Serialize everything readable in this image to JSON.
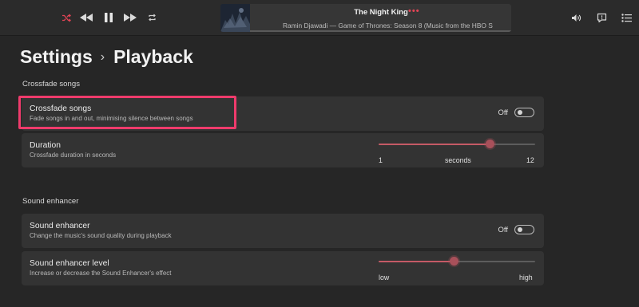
{
  "player": {
    "title": "The Night King",
    "more": "•••",
    "subtitle": "Ramin Djawadi — Game of Thrones: Season 8 (Music from the HBO S",
    "accent": "#e24455",
    "controls": [
      "shuffle-icon",
      "previous-icon",
      "pause-icon",
      "next-icon",
      "repeat-icon"
    ],
    "right_controls": [
      "volume-icon",
      "lyrics-icon",
      "queue-icon"
    ]
  },
  "breadcrumb": {
    "parent": "Settings",
    "separator": "›",
    "current": "Playback"
  },
  "crossfade": {
    "section_title": "Crossfade songs",
    "toggle": {
      "title": "Crossfade songs",
      "description": "Fade songs in and out, minimising silence between songs",
      "state": "Off"
    },
    "duration": {
      "title": "Duration",
      "description": "Crossfade duration in seconds",
      "min": "1",
      "unit": "seconds",
      "max": "12",
      "value_fraction": 0.71
    }
  },
  "enhancer": {
    "section_title": "Sound enhancer",
    "toggle": {
      "title": "Sound enhancer",
      "description": "Change the music's sound quality during playback",
      "state": "Off"
    },
    "level": {
      "title": "Sound enhancer level",
      "description": "Increase or decrease the Sound Enhancer's effect",
      "min": "low",
      "max": "high",
      "value_fraction": 0.48
    }
  },
  "colors": {
    "background": "#262626",
    "card": "#333333",
    "slider_accent": "#c55a66",
    "highlight": "#ef3b6c"
  }
}
